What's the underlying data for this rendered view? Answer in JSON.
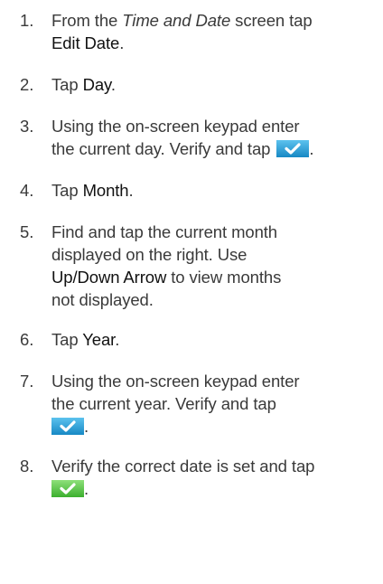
{
  "steps": [
    {
      "number": "1.",
      "pre": "From the ",
      "em": "Time and Date",
      "mid": " screen tap",
      "ui": "Edit Date",
      "post": "."
    },
    {
      "number": "2.",
      "pre": "Tap ",
      "ui": "Day",
      "post": "."
    },
    {
      "number": "3.",
      "line1": "Using the on-screen keypad enter",
      "line2": "the current day. Verify and tap ",
      "post": ".",
      "icon": "confirm-check-icon"
    },
    {
      "number": "4.",
      "pre": "Tap ",
      "ui": "Month",
      "post": "."
    },
    {
      "number": "5.",
      "line1": "Find and tap the current month",
      "line2": "displayed on the right. Use",
      "ui": "Up/Down Arrow",
      "line3_post": " to view months",
      "line4": "not displayed."
    },
    {
      "number": "6.",
      "pre": "Tap ",
      "ui": "Year",
      "post": "."
    },
    {
      "number": "7.",
      "line1": "Using the on-screen keypad enter",
      "line2": "the current year. Verify and tap",
      "post": ".",
      "icon": "confirm-check-icon"
    },
    {
      "number": "8.",
      "line1": "Verify the correct date is set and tap",
      "post": ".",
      "icon": "confirm-check-icon"
    }
  ],
  "colors": {
    "text": "#3a3a3a",
    "button_blue": "#1f9fd6",
    "button_green": "#5cc84a"
  }
}
